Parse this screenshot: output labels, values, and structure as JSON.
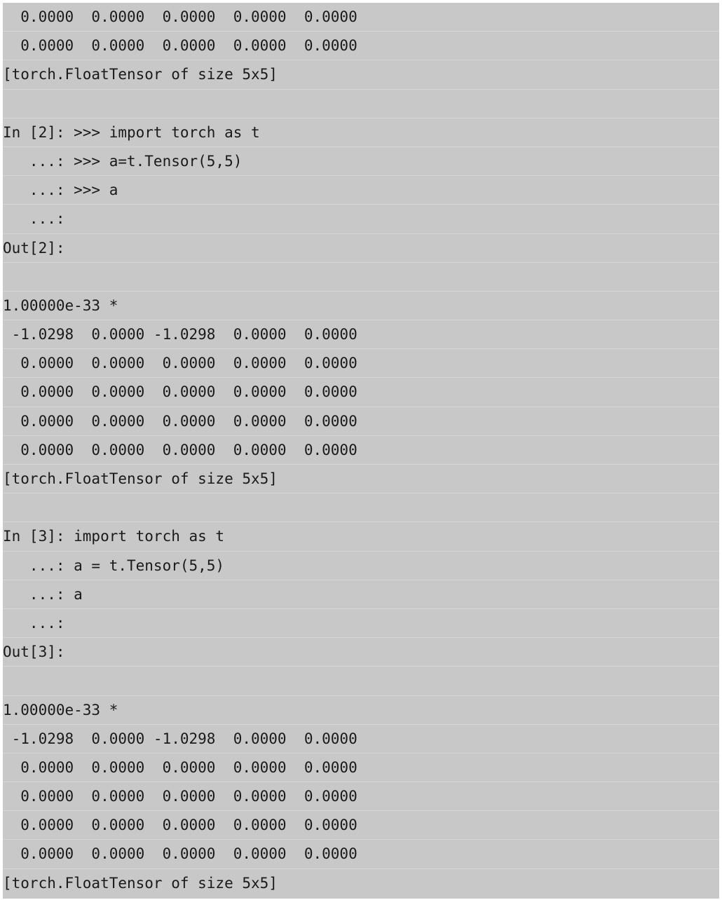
{
  "console": {
    "lines": [
      "  0.0000  0.0000  0.0000  0.0000  0.0000",
      "  0.0000  0.0000  0.0000  0.0000  0.0000",
      "[torch.FloatTensor of size 5x5]",
      "",
      "In [2]: >>> import torch as t",
      "   ...: >>> a=t.Tensor(5,5)",
      "   ...: >>> a",
      "   ...:",
      "Out[2]:",
      "",
      "1.00000e-33 *",
      " -1.0298  0.0000 -1.0298  0.0000  0.0000",
      "  0.0000  0.0000  0.0000  0.0000  0.0000",
      "  0.0000  0.0000  0.0000  0.0000  0.0000",
      "  0.0000  0.0000  0.0000  0.0000  0.0000",
      "  0.0000  0.0000  0.0000  0.0000  0.0000",
      "[torch.FloatTensor of size 5x5]",
      "",
      "In [3]: import torch as t",
      "   ...: a = t.Tensor(5,5)",
      "   ...: a",
      "   ...:",
      "Out[3]:",
      "",
      "1.00000e-33 *",
      " -1.0298  0.0000 -1.0298  0.0000  0.0000",
      "  0.0000  0.0000  0.0000  0.0000  0.0000",
      "  0.0000  0.0000  0.0000  0.0000  0.0000",
      "  0.0000  0.0000  0.0000  0.0000  0.0000",
      "  0.0000  0.0000  0.0000  0.0000  0.0000",
      "[torch.FloatTensor of size 5x5]"
    ]
  }
}
